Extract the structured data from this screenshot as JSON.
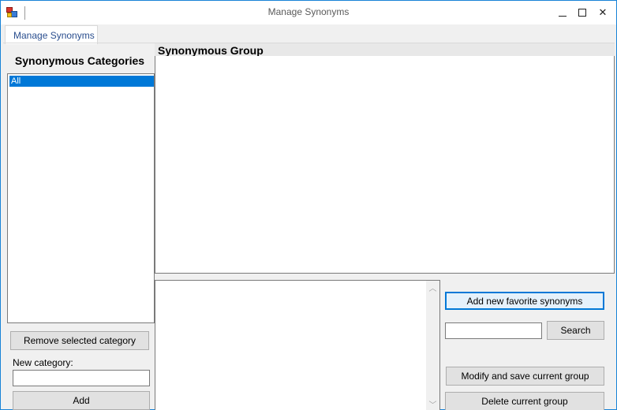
{
  "window": {
    "title": "Manage Synonyms",
    "icon": "app-icon",
    "controls": [
      "minimize-icon",
      "maximize-icon",
      "close-icon"
    ]
  },
  "tabs": [
    {
      "label": "Manage Synonyms",
      "selected": true
    }
  ],
  "categories": {
    "heading": "Synonymous Categories",
    "items": [
      {
        "label": "All",
        "selected": true
      }
    ],
    "remove_button": "Remove selected category",
    "new_category_label": "New category:",
    "new_category_value": "",
    "add_button": "Add"
  },
  "group": {
    "heading": "Synonymous Group",
    "content": "",
    "editor_value": ""
  },
  "actions": {
    "add_favorite_button": "Add new favorite synonyms",
    "search_value": "",
    "search_button": "Search",
    "modify_button": "Modify and save current group",
    "delete_button": "Delete current group"
  },
  "colors": {
    "selection": "#0078d7",
    "window_border": "#1883d7",
    "background": "#f0f0f0"
  }
}
